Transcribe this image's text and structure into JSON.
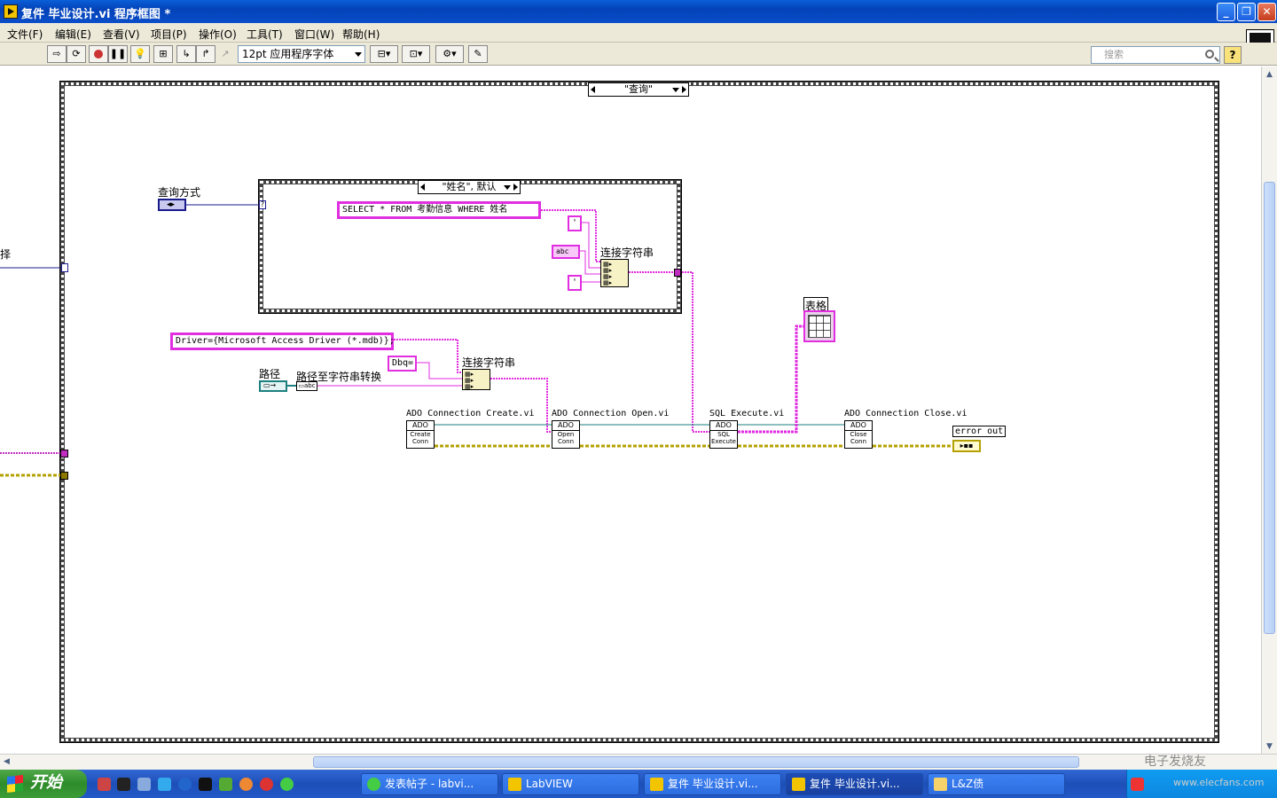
{
  "window": {
    "title": "复件 毕业设计.vi 程序框图 *",
    "buttons": {
      "minimize": "_",
      "restore": "❐",
      "close": "✕"
    }
  },
  "menu": [
    "文件(F)",
    "编辑(E)",
    "查看(V)",
    "项目(P)",
    "操作(O)",
    "工具(T)",
    "窗口(W)",
    "帮助(H)"
  ],
  "toolbar": {
    "font": "12pt 应用程序字体",
    "search_placeholder": "搜索",
    "help": "?"
  },
  "diagram": {
    "outer_case_selector": "\"查询\"",
    "inner_case_selector": "\"姓名\", 默认",
    "left_partial_label": "择",
    "query_mode_label": "查询方式",
    "sql_string": "SELECT * FROM 考勤信息 WHERE 姓名",
    "quote_const": "'",
    "abc_const": "abc",
    "concat_label_1": "连接字符串",
    "concat_label_2": "连接字符串",
    "driver_string": "Driver={Microsoft Access Driver (*.mdb)};",
    "dbq_string": "Dbq=",
    "path_label": "路径",
    "path_to_string_label": "路径至字符串转换",
    "table_label": "表格",
    "subvis": [
      {
        "label": "ADO Connection Create.vi",
        "hdr": "ADO",
        "body": "Create Conn"
      },
      {
        "label": "ADO Connection Open.vi",
        "hdr": "ADO",
        "body": "Open Conn"
      },
      {
        "label": "SQL Execute.vi",
        "hdr": "ADO",
        "body": "SQL Execute"
      },
      {
        "label": "ADO Connection Close.vi",
        "hdr": "ADO",
        "body": "Close Conn"
      }
    ],
    "error_out_label": "error out"
  },
  "taskbar": {
    "start": "开始",
    "tasks": [
      "发表帖子 - labvi...",
      "LabVIEW",
      "复件 毕业设计.vi...",
      "复件 毕业设计.vi...",
      "L&Z债"
    ],
    "watermark": "电子发烧友",
    "watermark_sub": "www.elecfans.com"
  },
  "colors": {
    "string_wire": "#e02ee0",
    "error_wire": "#b4a000",
    "ref_wire": "#1e7f7f",
    "enum_wire": "#1a1a8c",
    "titlebar": "#0a4ec9",
    "taskbar": "#2258c7"
  }
}
